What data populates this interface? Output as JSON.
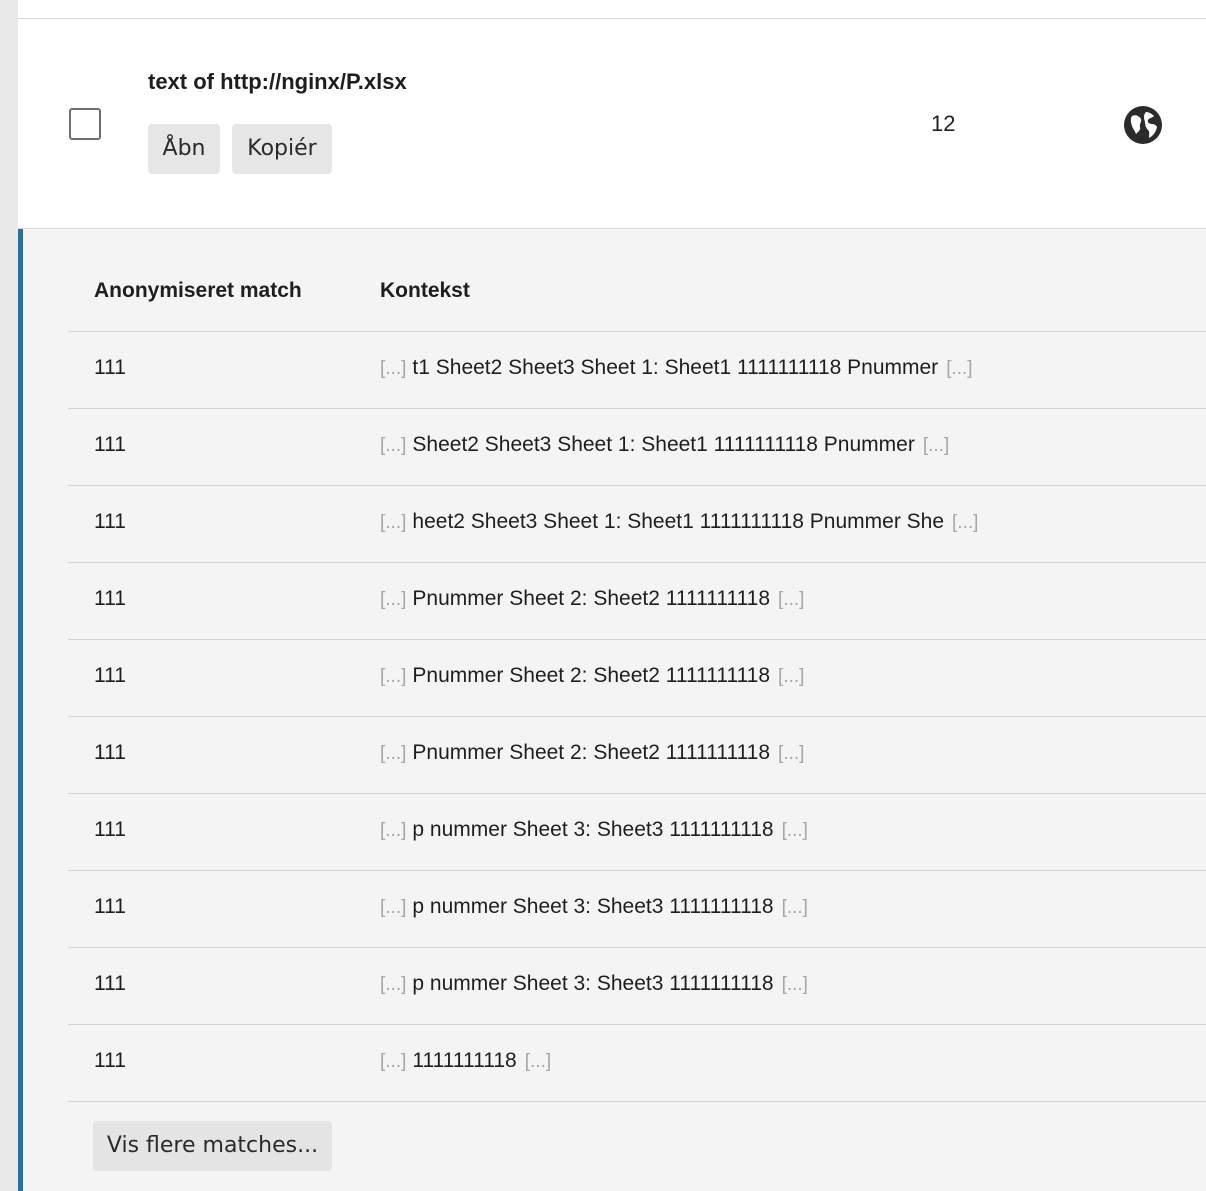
{
  "result": {
    "title": "text of http://nginx/P.xlsx",
    "open_label": "Åbn",
    "copy_label": "Kopiér",
    "match_count": "12",
    "source_icon": "globe-icon",
    "checkbox_checked": false
  },
  "matches": {
    "columns": {
      "match": "Anonymiseret match",
      "context": "Kontekst"
    },
    "ellipsis": "[...]",
    "rows": [
      {
        "match": "111",
        "context": "t1 Sheet2 Sheet3 Sheet 1: Sheet1 1111111118 Pnummer"
      },
      {
        "match": "111",
        "context": "Sheet2 Sheet3 Sheet 1: Sheet1 1111111118 Pnummer"
      },
      {
        "match": "111",
        "context": "heet2 Sheet3 Sheet 1: Sheet1 1111111118 Pnummer She"
      },
      {
        "match": "111",
        "context": "Pnummer Sheet 2: Sheet2 1111111118"
      },
      {
        "match": "111",
        "context": "Pnummer Sheet 2: Sheet2 1111111118"
      },
      {
        "match": "111",
        "context": "Pnummer Sheet 2: Sheet2 1111111118"
      },
      {
        "match": "111",
        "context": "p nummer Sheet 3: Sheet3 1111111118"
      },
      {
        "match": "111",
        "context": "p nummer Sheet 3: Sheet3 1111111118"
      },
      {
        "match": "111",
        "context": "p nummer Sheet 3: Sheet3 1111111118"
      },
      {
        "match": "111",
        "context": "1111111118"
      }
    ],
    "show_more_label": "Vis flere matches..."
  },
  "colors": {
    "accent": "#2d6f99",
    "panel_bg": "#f4f4f4",
    "button_bg": "#e6e6e6",
    "ellipsis": "#a6a6a6"
  }
}
